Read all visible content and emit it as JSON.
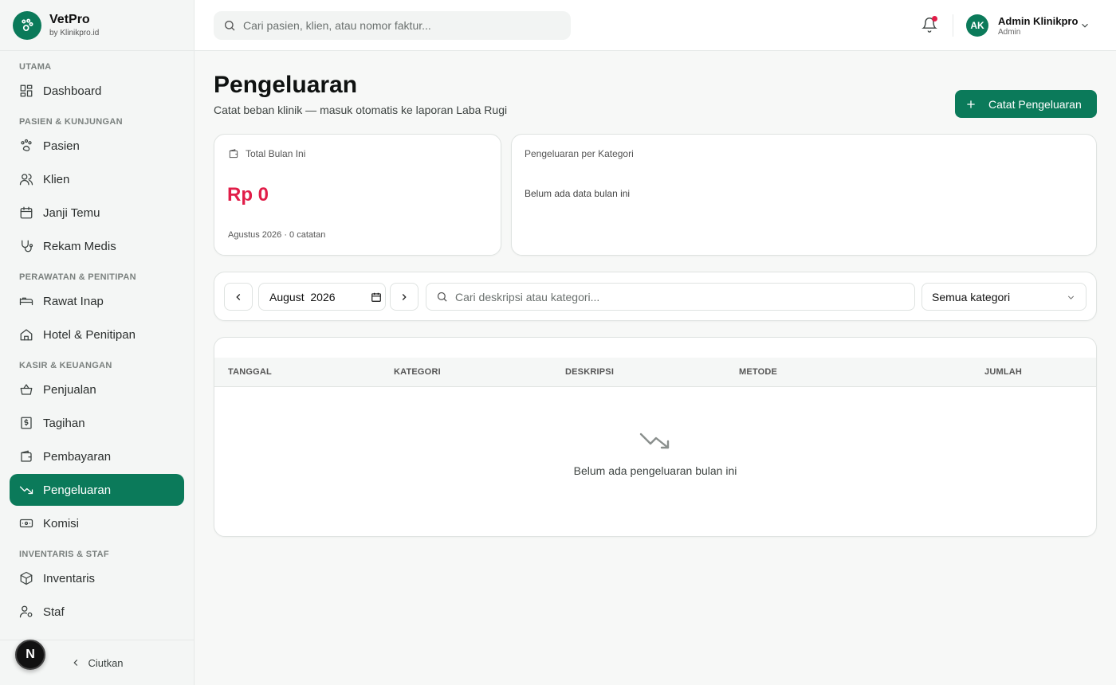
{
  "brand": {
    "name": "VetPro",
    "sub": "by Klinikpro.id"
  },
  "sidebar": {
    "sections": [
      {
        "title": "UTAMA",
        "items": [
          {
            "label": "Dashboard",
            "icon": "dashboard-icon"
          }
        ]
      },
      {
        "title": "PASIEN & KUNJUNGAN",
        "items": [
          {
            "label": "Pasien",
            "icon": "paw-icon"
          },
          {
            "label": "Klien",
            "icon": "users-icon"
          },
          {
            "label": "Janji Temu",
            "icon": "calendar-icon"
          },
          {
            "label": "Rekam Medis",
            "icon": "stethoscope-icon"
          }
        ]
      },
      {
        "title": "PERAWATAN & PENITIPAN",
        "items": [
          {
            "label": "Rawat Inap",
            "icon": "bed-icon"
          },
          {
            "label": "Hotel & Penitipan",
            "icon": "home-icon"
          }
        ]
      },
      {
        "title": "KASIR & KEUANGAN",
        "items": [
          {
            "label": "Penjualan",
            "icon": "basket-icon"
          },
          {
            "label": "Tagihan",
            "icon": "invoice-icon"
          },
          {
            "label": "Pembayaran",
            "icon": "wallet-icon"
          },
          {
            "label": "Pengeluaran",
            "icon": "trending-down-icon",
            "active": true
          },
          {
            "label": "Komisi",
            "icon": "banknote-icon"
          }
        ]
      },
      {
        "title": "INVENTARIS & STAF",
        "items": [
          {
            "label": "Inventaris",
            "icon": "box-icon"
          },
          {
            "label": "Staf",
            "icon": "user-cog-icon"
          }
        ]
      }
    ],
    "collapse_label": "Ciutkan",
    "badge": "N"
  },
  "topbar": {
    "search_placeholder": "Cari pasien, klien, atau nomor faktur...",
    "user_initials": "AK",
    "user_name": "Admin Klinikpro",
    "user_role": "Admin"
  },
  "page": {
    "title": "Pengeluaran",
    "subtitle": "Catat beban klinik — masuk otomatis ke laporan Laba Rugi",
    "primary_button": "Catat Pengeluaran"
  },
  "summary": {
    "total_label": "Total Bulan Ini",
    "total_value": "Rp 0",
    "total_footnote": "Agustus 2026 · 0 catatan",
    "category_label": "Pengeluaran per Kategori",
    "category_empty": "Belum ada data bulan ini"
  },
  "filters": {
    "month_value": "August  2026",
    "search_placeholder": "Cari deskripsi atau kategori...",
    "category_select": "Semua kategori"
  },
  "table": {
    "columns": [
      "TANGGAL",
      "KATEGORI",
      "DESKRIPSI",
      "METODE",
      "JUMLAH"
    ],
    "empty_text": "Belum ada pengeluaran bulan ini"
  },
  "colors": {
    "accent": "#0b7a5a",
    "danger": "#e11d48"
  }
}
